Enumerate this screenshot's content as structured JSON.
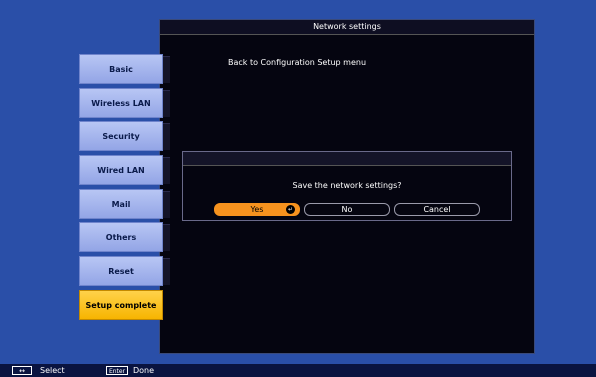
{
  "panel": {
    "title": "Network settings",
    "back_link": "Back to Configuration Setup menu"
  },
  "sidebar": {
    "items": [
      {
        "label": "Basic"
      },
      {
        "label": "Wireless LAN"
      },
      {
        "label": "Security"
      },
      {
        "label": "Wired LAN"
      },
      {
        "label": "Mail"
      },
      {
        "label": "Others"
      },
      {
        "label": "Reset"
      },
      {
        "label": "Setup complete",
        "active": true
      }
    ]
  },
  "dialog": {
    "question": "Save the network settings?",
    "buttons": {
      "yes": "Yes",
      "no": "No",
      "cancel": "Cancel"
    },
    "selected": "yes"
  },
  "footer": {
    "select_key": "↔",
    "select_label": "Select",
    "enter_key": "Enter",
    "done_label": "Done"
  },
  "colors": {
    "background": "#2a4fa8",
    "panel": "#050510",
    "sidebar_button": "#a7b6ef",
    "active_button": "#fcc51a",
    "selected_option": "#f7931e"
  }
}
